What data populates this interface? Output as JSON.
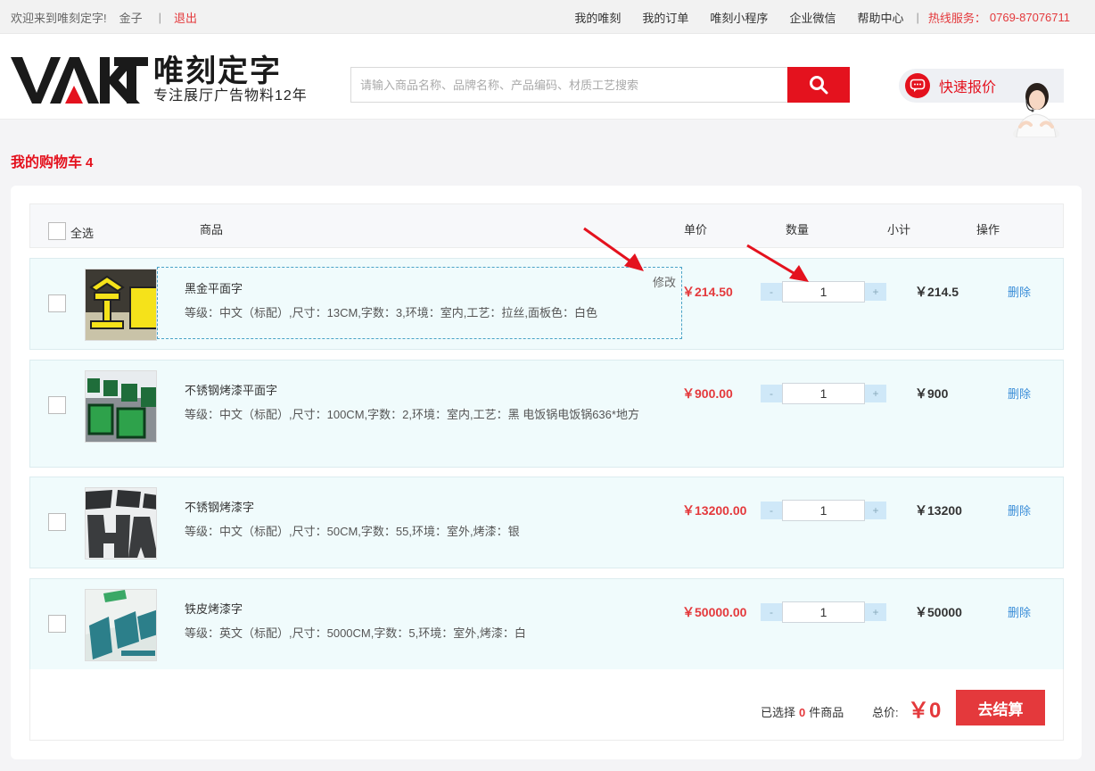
{
  "topbar": {
    "welcome": "欢迎来到唯刻定字!",
    "username": "金子",
    "logout": "退出",
    "links": [
      "我的唯刻",
      "我的订单",
      "唯刻小程序",
      "企业微信",
      "帮助中心"
    ],
    "hotline_label": "热线服务：",
    "hotline_number": "0769-87076711"
  },
  "header": {
    "brand_name": "唯刻定字",
    "slogan": "专注展厅广告物料12年",
    "search_placeholder": "请输入商品名称、品牌名称、产品编码、材质工艺搜索",
    "quick_quote": "快速报价"
  },
  "cart": {
    "title": "我的购物车",
    "count": "4",
    "headers": {
      "select_all": "全选",
      "product": "商品",
      "unit_price": "单价",
      "quantity": "数量",
      "subtotal": "小计",
      "action": "操作"
    },
    "edit_label": "修改",
    "delete_label": "删除",
    "items": [
      {
        "name": "黑金平面字",
        "spec": "等级：中文（标配）,尺寸：13CM,字数：3,环境：室内,工艺：拉丝,面板色：白色",
        "price": "￥214.50",
        "qty": "1",
        "subtotal": "￥214.5"
      },
      {
        "name": "不锈钢烤漆平面字",
        "spec": "等级：中文（标配）,尺寸：100CM,字数：2,环境：室内,工艺：黑 电饭锅电饭锅636*地方",
        "price": "￥900.00",
        "qty": "1",
        "subtotal": "￥900"
      },
      {
        "name": "不锈钢烤漆字",
        "spec": "等级：中文（标配）,尺寸：50CM,字数：55,环境：室外,烤漆：银",
        "price": "￥13200.00",
        "qty": "1",
        "subtotal": "￥13200"
      },
      {
        "name": "铁皮烤漆字",
        "spec": "等级：英文（标配）,尺寸：5000CM,字数：5,环境：室外,烤漆：白",
        "price": "￥50000.00",
        "qty": "1",
        "subtotal": "￥50000"
      }
    ],
    "footer": {
      "selected_prefix": "已选择",
      "selected_count": "0",
      "selected_suffix": "件商品",
      "total_label": "总价:",
      "total_amount": "￥0",
      "checkout": "去结算"
    }
  },
  "colors": {
    "brand_red": "#e4121e",
    "price_red": "#e4393c",
    "link_blue": "#3b8ed8",
    "row_bg": "#f0fbfc"
  }
}
